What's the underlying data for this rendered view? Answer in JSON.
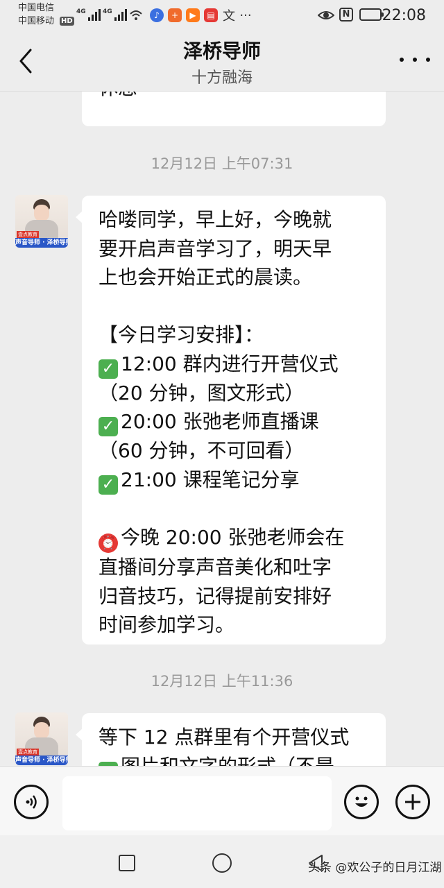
{
  "status_bar": {
    "carrier_1": "中国电信",
    "carrier_2": "中国移动",
    "hd_label": "HD",
    "network_1": "4G",
    "network_2": "4G",
    "nfc_label": "N",
    "time": "22:08"
  },
  "header": {
    "title": "泽桥导师",
    "subtitle": "十方融海"
  },
  "avatar": {
    "badge": "壹点教育",
    "band_text": "声音导师 · 泽桥导师"
  },
  "messages": [
    {
      "type": "text",
      "lines": [
        "休息 ~"
      ]
    },
    {
      "type": "timestamp",
      "text": "12月12日 上午07:31"
    },
    {
      "type": "text",
      "lines": [
        "哈喽同学，早上好，今晚就",
        "要开启声音学习了，明天早",
        "上也会开始正式的晨读。",
        "",
        "【今日学习安排】：",
        "12:00 群内进行开营仪式",
        "（20 分钟，图文形式）",
        "20:00 张弛老师直播课",
        "（60 分钟，不可回看）",
        "21:00 课程笔记分享",
        "",
        "今晚 20:00 张弛老师会在",
        "直播间分享声音美化和吐字",
        "归音技巧，记得提前安排好",
        "时间参加学习。"
      ]
    },
    {
      "type": "timestamp",
      "text": "12月12日 上午11:36"
    },
    {
      "type": "text",
      "lines": [
        "等下 12 点群里有个开营仪式",
        "图片和文字的形式（不是"
      ]
    }
  ],
  "input_bar": {
    "placeholder": ""
  },
  "watermark": "头条 @欢公子的日月江湖",
  "colors": {
    "background": "#ededed",
    "bubble": "#ffffff",
    "check_green": "#4caf50",
    "alarm_red": "#e53935",
    "avatar_band": "#2a57c7"
  }
}
